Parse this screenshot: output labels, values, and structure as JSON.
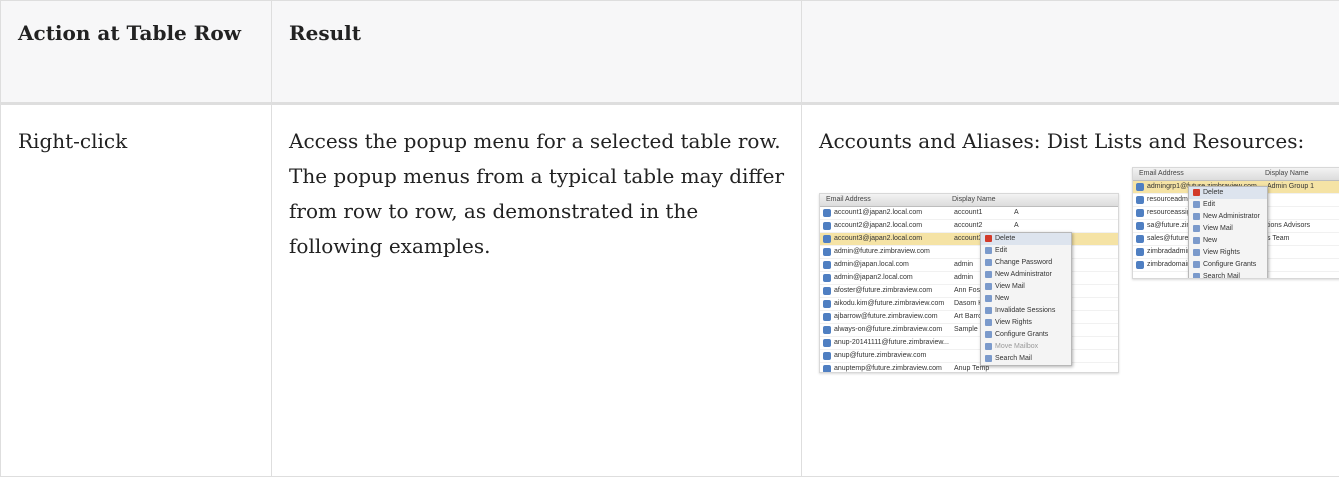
{
  "table": {
    "headers": [
      "Action at Table Row",
      "Result",
      ""
    ],
    "rows": [
      {
        "action": "Right-click",
        "result": "Access the popup menu for a selected table row. The popup menus from a typical table may differ from row to row, as demonstrated in the following examples.",
        "caption": "Accounts and Aliases: Dist Lists and Resources:"
      }
    ]
  },
  "screenshot1": {
    "columns": [
      "Email Address",
      "Display Name"
    ],
    "rows": [
      {
        "email": "account1@japan2.local.com",
        "name": "account1",
        "extra": "A"
      },
      {
        "email": "account2@japan2.local.com",
        "name": "account2",
        "extra": "A"
      },
      {
        "email": "account3@japan2.local.com",
        "name": "account3",
        "extra": ""
      },
      {
        "email": "admin@future.zimbraview.com",
        "name": "",
        "extra": ""
      },
      {
        "email": "admin@japan.local.com",
        "name": "admin",
        "extra": ""
      },
      {
        "email": "admin@japan2.local.com",
        "name": "admin",
        "extra": ""
      },
      {
        "email": "afoster@future.zimbraview.com",
        "name": "Ann Foster",
        "extra": ""
      },
      {
        "email": "aikodu.kim@future.zimbraview.com",
        "name": "Dasom Kim",
        "extra": ""
      },
      {
        "email": "ajbarrow@future.zimbraview.com",
        "name": "Art Barrow",
        "extra": ""
      },
      {
        "email": "always-on@future.zimbraview.com",
        "name": "Sample Mailb",
        "extra": ""
      },
      {
        "email": "anup-20141111@future.zimbraview...",
        "name": "",
        "extra": ""
      },
      {
        "email": "anup@future.zimbraview.com",
        "name": "",
        "extra": ""
      },
      {
        "email": "anuptemp@future.zimbraview.com",
        "name": "Anup Temp",
        "extra": ""
      }
    ],
    "menu": [
      "Delete",
      "Edit",
      "Change Password",
      "New Administrator",
      "View Mail",
      "New",
      "Invalidate Sessions",
      "View Rights",
      "Configure Grants",
      "Move Mailbox",
      "Search Mail"
    ]
  },
  "screenshot2": {
    "columns": [
      "Email Address",
      "Display Name"
    ],
    "rows": [
      {
        "email": "admingrp1@future.zimbraview.com",
        "name": "Admin Group 1"
      },
      {
        "email": "resourceadmin@",
        "name": ""
      },
      {
        "email": "resourceassign",
        "name": ""
      },
      {
        "email": "sa@future.zimbr",
        "name": "tions Advisors"
      },
      {
        "email": "sales@future.zir",
        "name": "s Team"
      },
      {
        "email": "zimbradadmins",
        "name": ""
      },
      {
        "email": "zimbradomainad",
        "name": ""
      }
    ],
    "menu": [
      "Delete",
      "Edit",
      "New Administrator",
      "View Mail",
      "New",
      "View Rights",
      "Configure Grants",
      "Search Mail"
    ]
  }
}
